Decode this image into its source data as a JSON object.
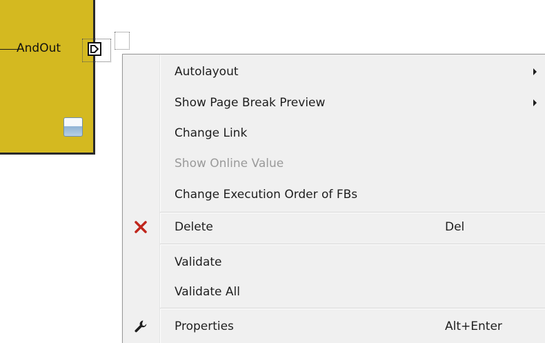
{
  "function_block": {
    "output_label": "AndOut",
    "color": "#d4b920"
  },
  "context_menu": {
    "items": [
      {
        "label": "Autolayout",
        "submenu": true
      },
      {
        "label": "Show Page Break Preview",
        "submenu": true
      },
      {
        "label": "Change Link"
      },
      {
        "label": "Show Online Value",
        "disabled": true
      },
      {
        "label": "Change Execution Order of FBs"
      },
      {
        "label": "Delete",
        "shortcut": "Del",
        "icon": "delete-x-icon"
      },
      {
        "label": "Validate"
      },
      {
        "label": "Validate All"
      },
      {
        "label": "Properties",
        "shortcut": "Alt+Enter",
        "icon": "wrench-icon"
      }
    ],
    "colors": {
      "background": "#f0f0f0",
      "text": "#1e1e1e",
      "disabled_text": "#9a9a9a",
      "delete_icon": "#c0261c"
    }
  }
}
